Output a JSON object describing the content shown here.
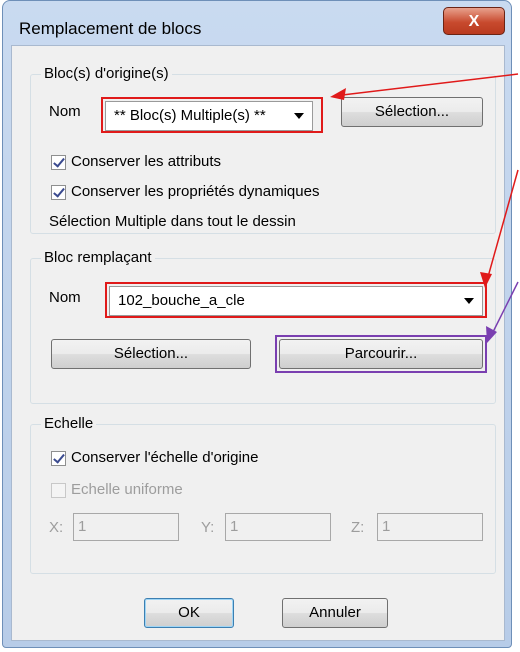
{
  "window": {
    "title": "Remplacement de blocs",
    "close_label": "X"
  },
  "origin_group": {
    "legend": "Bloc(s) d'origine(s)",
    "name_label": "Nom",
    "name_value": "** Bloc(s) Multiple(s) **",
    "selection_button": "Sélection...",
    "keep_attributes": {
      "label": "Conserver les attributs",
      "checked": true
    },
    "keep_dynamic": {
      "label": "Conserver les propriétés dynamiques",
      "checked": true
    },
    "status_text": "Sélection Multiple dans tout le dessin"
  },
  "replacement_group": {
    "legend": "Bloc remplaçant",
    "name_label": "Nom",
    "name_value": "102_bouche_a_cle",
    "selection_button": "Sélection...",
    "browse_button": "Parcourir..."
  },
  "scale_group": {
    "legend": "Echelle",
    "keep_scale": {
      "label": "Conserver l'échelle d'origine",
      "checked": true
    },
    "uniform_scale": {
      "label": "Echelle uniforme",
      "checked": false
    },
    "x_label": "X:",
    "x_value": "1",
    "y_label": "Y:",
    "y_value": "1",
    "z_label": "Z:",
    "z_value": "1"
  },
  "footer": {
    "ok_label": "OK",
    "cancel_label": "Annuler"
  },
  "annotation_colors": {
    "highlight_red": "#e01a1a",
    "highlight_purple": "#7a3fb0"
  }
}
